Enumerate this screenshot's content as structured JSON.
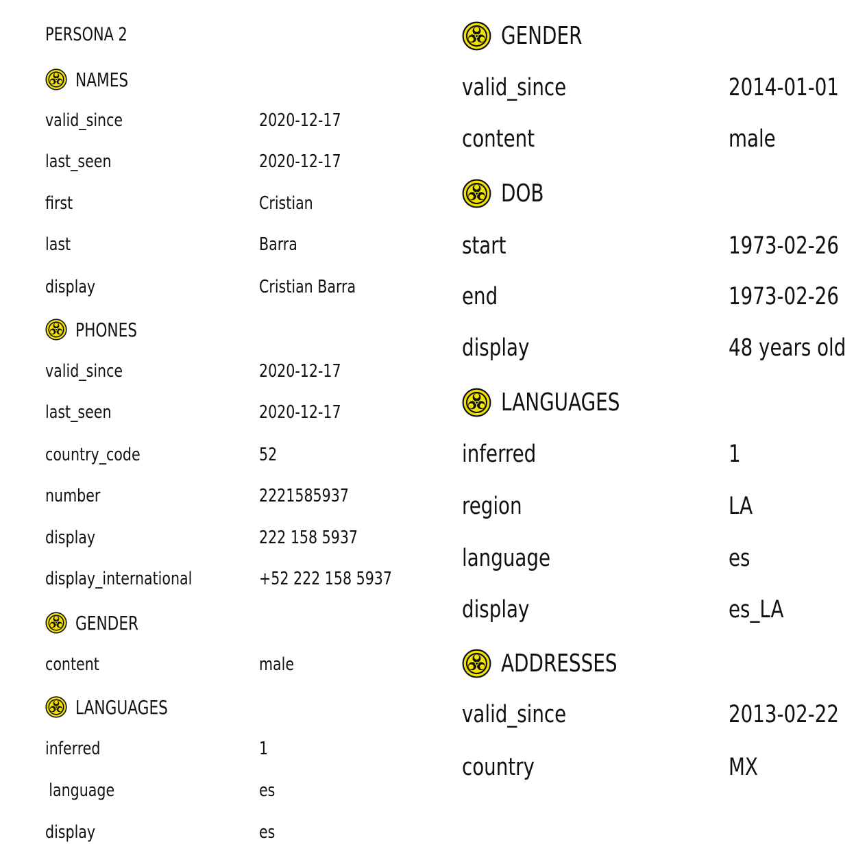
{
  "left": {
    "title": "PERSONA 2",
    "icon": "biohazard-icon",
    "names": {
      "heading": "NAMES",
      "rows": [
        {
          "key": "valid_since",
          "value": "2020-12-17"
        },
        {
          "key": "last_seen",
          "value": "2020-12-17"
        },
        {
          "key": "first",
          "value": "Cristian"
        },
        {
          "key": "last",
          "value": "Barra"
        },
        {
          "key": "display",
          "value": "Cristian Barra"
        }
      ]
    },
    "phones": {
      "heading": "PHONES",
      "rows": [
        {
          "key": "valid_since",
          "value": "2020-12-17"
        },
        {
          "key": "last_seen",
          "value": "2020-12-17"
        },
        {
          "key": "country_code",
          "value": "52"
        },
        {
          "key": "number",
          "value": "2221585937"
        },
        {
          "key": "display",
          "value": "222 158 5937"
        },
        {
          "key": "display_international",
          "value": "+52 222 158 5937"
        }
      ]
    },
    "gender": {
      "heading": "GENDER",
      "rows": [
        {
          "key": "content",
          "value": "male"
        }
      ]
    },
    "languages": {
      "heading": "LANGUAGES",
      "rows": [
        {
          "key": "inferred",
          "value": "1"
        },
        {
          "key": "language",
          "value": "es"
        },
        {
          "key": "display",
          "value": "es"
        }
      ]
    }
  },
  "right": {
    "gender": {
      "heading": "GENDER",
      "rows": [
        {
          "key": "valid_since",
          "value": "2014-01-01"
        },
        {
          "key": "content",
          "value": "male"
        }
      ]
    },
    "dob": {
      "heading": "DOB",
      "rows": [
        {
          "key": "start",
          "value": "1973-02-26"
        },
        {
          "key": "end",
          "value": "1973-02-26"
        },
        {
          "key": "display",
          "value": "48 years old"
        }
      ]
    },
    "languages": {
      "heading": "LANGUAGES",
      "rows": [
        {
          "key": "inferred",
          "value": "1"
        },
        {
          "key": "region",
          "value": "LA"
        },
        {
          "key": "language",
          "value": "es"
        },
        {
          "key": "display",
          "value": "es_LA"
        }
      ]
    },
    "addresses": {
      "heading": "ADDRESSES",
      "rows": [
        {
          "key": "valid_since",
          "value": "2013-02-22"
        },
        {
          "key": "country",
          "value": "MX"
        }
      ]
    }
  },
  "colors": {
    "icon_fill": "#f2e400",
    "icon_ink": "#111111",
    "text": "#111111"
  }
}
